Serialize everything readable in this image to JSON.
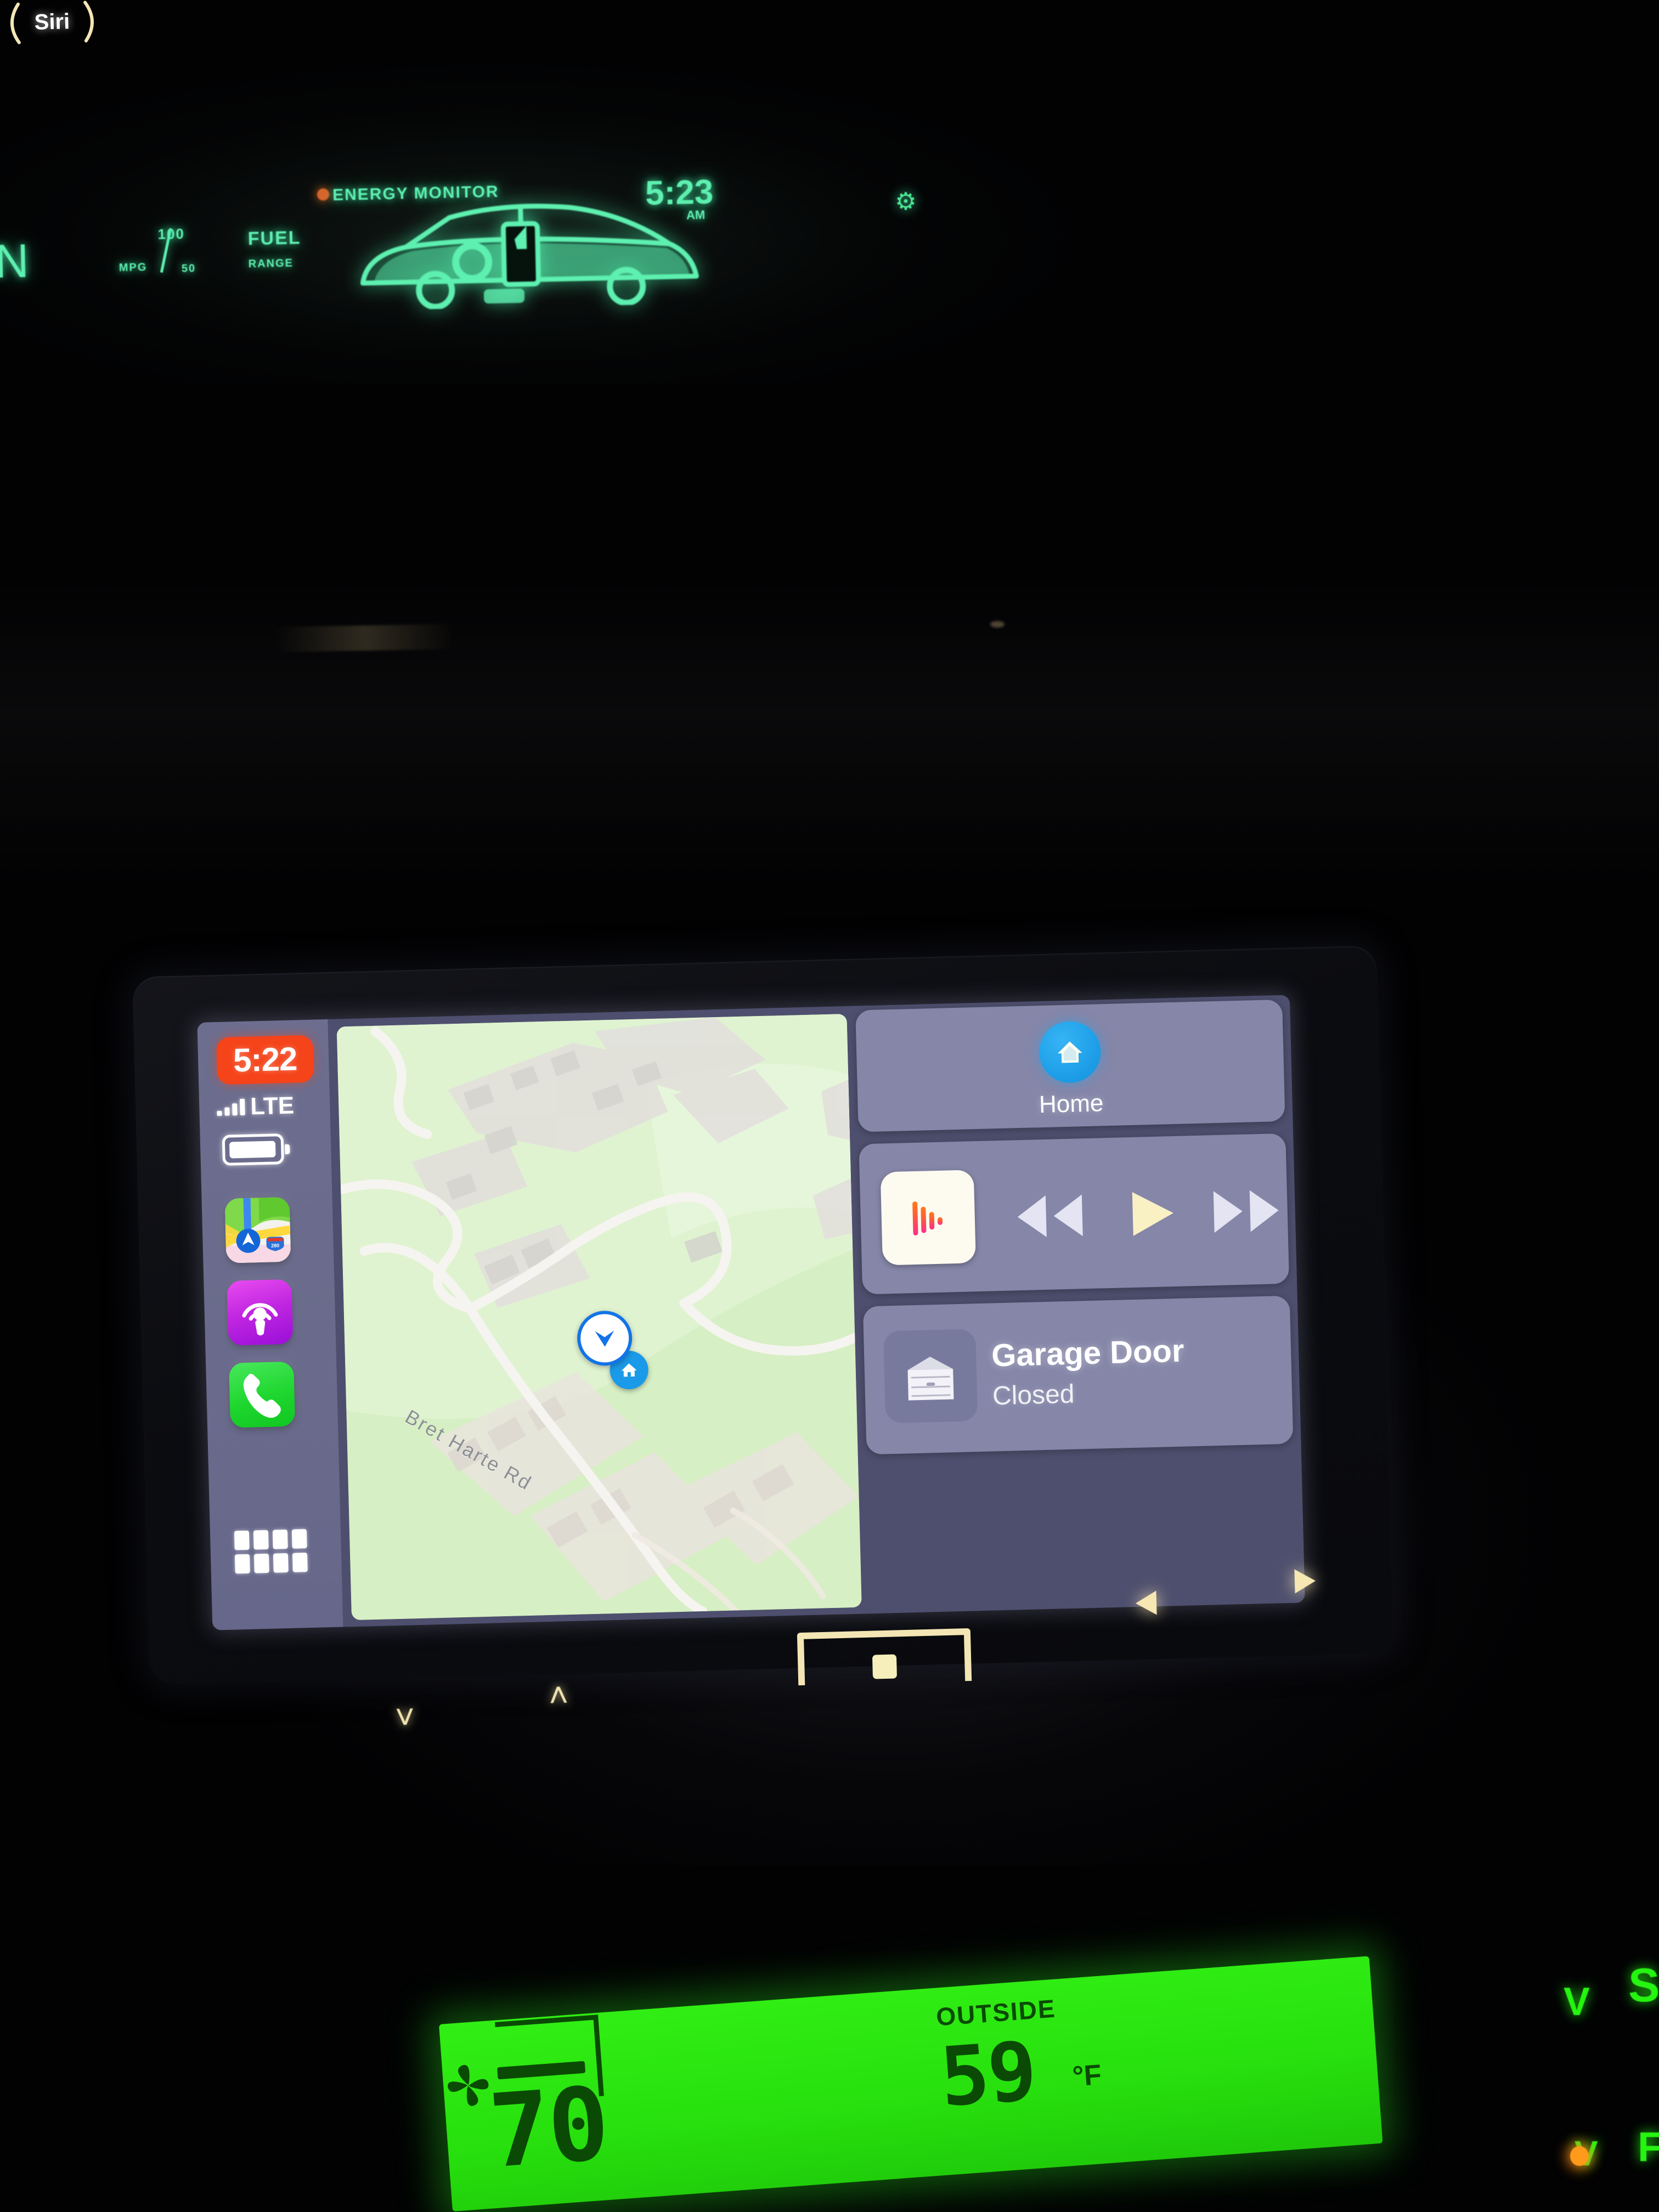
{
  "cluster": {
    "energy_monitor_label": "ENERGY MONITOR",
    "clock": "5:23",
    "clock_ampm": "AM",
    "gear": "N",
    "mpg_value": "100",
    "mpg_label": "MPG",
    "mpg_zero": "50",
    "fuel_line_1": "FUEL",
    "fuel_line_2": "RANGE",
    "indicator_icon": "gear-indicator-icon"
  },
  "carplay": {
    "status": {
      "time": "5:22",
      "carrier_tech": "LTE",
      "signal_bars": 4,
      "battery_level": 78,
      "signal_icon": "cellular-signal-icon",
      "battery_icon": "battery-icon"
    },
    "sidebar_apps": [
      {
        "name": "Maps",
        "icon": "maps-app-icon"
      },
      {
        "name": "Podcasts",
        "icon": "podcasts-app-icon"
      },
      {
        "name": "Phone",
        "icon": "phone-app-icon"
      }
    ],
    "app_grid": {
      "icon": "app-grid-icon",
      "dots": 8
    },
    "map": {
      "road_label": "Bret Harte Rd",
      "location_icon": "location-heading-arrow-icon",
      "home_pin_icon": "home-pin-icon",
      "background_color": "#d9f0c8",
      "road_color": "#f2efeb"
    },
    "widgets": {
      "home": {
        "label": "Home",
        "icon": "home-house-icon",
        "accent_color": "#1e9fe8"
      },
      "media": {
        "album_art_icon": "music-waveform-icon",
        "rewind_icon": "rewind-icon",
        "play_icon": "play-icon",
        "forward_icon": "fast-forward-icon",
        "play_highlight_color": "#f7efbc"
      },
      "garage": {
        "title": "Garage Door",
        "state": "Closed",
        "icon": "garage-door-icon"
      }
    },
    "card_color": "#8a8bad",
    "sidebar_color": "#6d6e8f"
  },
  "hardware": {
    "volume_down_icon": "chevron-down-icon",
    "volume_up_icon": "chevron-up-icon",
    "siri_label": "Siri",
    "display_bracket_icon": "display-frame-button-icon",
    "seek_prev_icon": "seek-previous-triangle-icon",
    "seek_next_icon": "seek-next-triangle-icon"
  },
  "hvac": {
    "driver_temp": "70",
    "outside_label": "OUTSIDE",
    "outside_temp": "59",
    "outside_unit": "°F",
    "fan_icon": "fan-icon",
    "vent_icon": "vent-direction-icon",
    "lcd_color": "#2ae80f",
    "lcd_text_color": "#0a4a04",
    "hardkeys": [
      "V",
      "S",
      "F",
      "V"
    ],
    "indicator_led_color": "#ff9a1a"
  }
}
